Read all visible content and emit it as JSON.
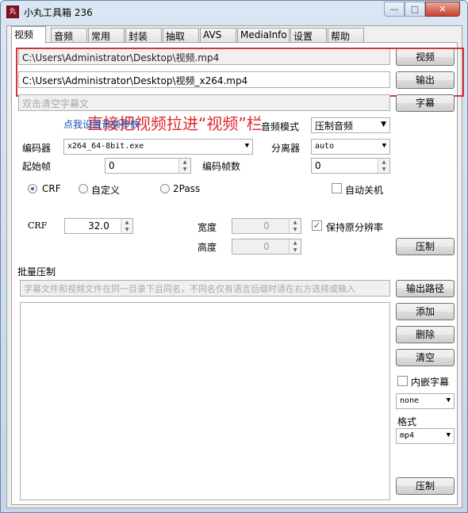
{
  "window": {
    "title": "小丸工具箱 236",
    "icon_text": "丸",
    "controls": {
      "minimize": "—",
      "maximize": "□",
      "close": "✕"
    }
  },
  "tabs": [
    "视频",
    "音频",
    "常用",
    "封装",
    "抽取",
    "AVS",
    "MediaInfo",
    "设置",
    "帮助"
  ],
  "video": {
    "input_path": "C:\\Users\\Administrator\\Desktop\\视频.mp4",
    "output_path": "C:\\Users\\Administrator\\Desktop\\视频_x264.mp4",
    "subtitle_placeholder": "双击清空字幕文",
    "video_button": "视频",
    "output_button": "输出",
    "subtitle_button": "字幕",
    "annotation": "直接把视频拉进“视频”栏",
    "audio_params_link": "点我设置音频参数",
    "audio_mode_label": "音频模式",
    "audio_mode_value": "压制音频",
    "encoder_label": "编码器",
    "encoder_value": "x264_64-8bit.exe",
    "splitter_label": "分离器",
    "splitter_value": "auto",
    "start_frame_label": "起始帧",
    "start_frame_value": "0",
    "encode_frames_label": "编码帧数",
    "encode_frames_value": "0",
    "mode_crf": "CRF",
    "mode_custom": "自定义",
    "mode_2pass": "2Pass",
    "auto_shutdown": "自动关机",
    "crf_label": "CRF",
    "crf_value": "32.0",
    "width_label": "宽度",
    "width_value": "0",
    "height_label": "高度",
    "height_value": "0",
    "keep_resolution": "保持原分辨率",
    "compress_button": "压制"
  },
  "batch": {
    "label": "批量压制",
    "hint": "字幕文件和视频文件在同一目录下且同名，不同名仅有语言后缀时请在右方选择或输入",
    "output_path_button": "输出路径",
    "add_button": "添加",
    "delete_button": "删除",
    "clear_button": "清空",
    "embed_subtitles": "内嵌字幕",
    "subtitle_lang_value": "none",
    "format_label": "格式",
    "format_value": "mp4",
    "compress_button": "压制"
  }
}
